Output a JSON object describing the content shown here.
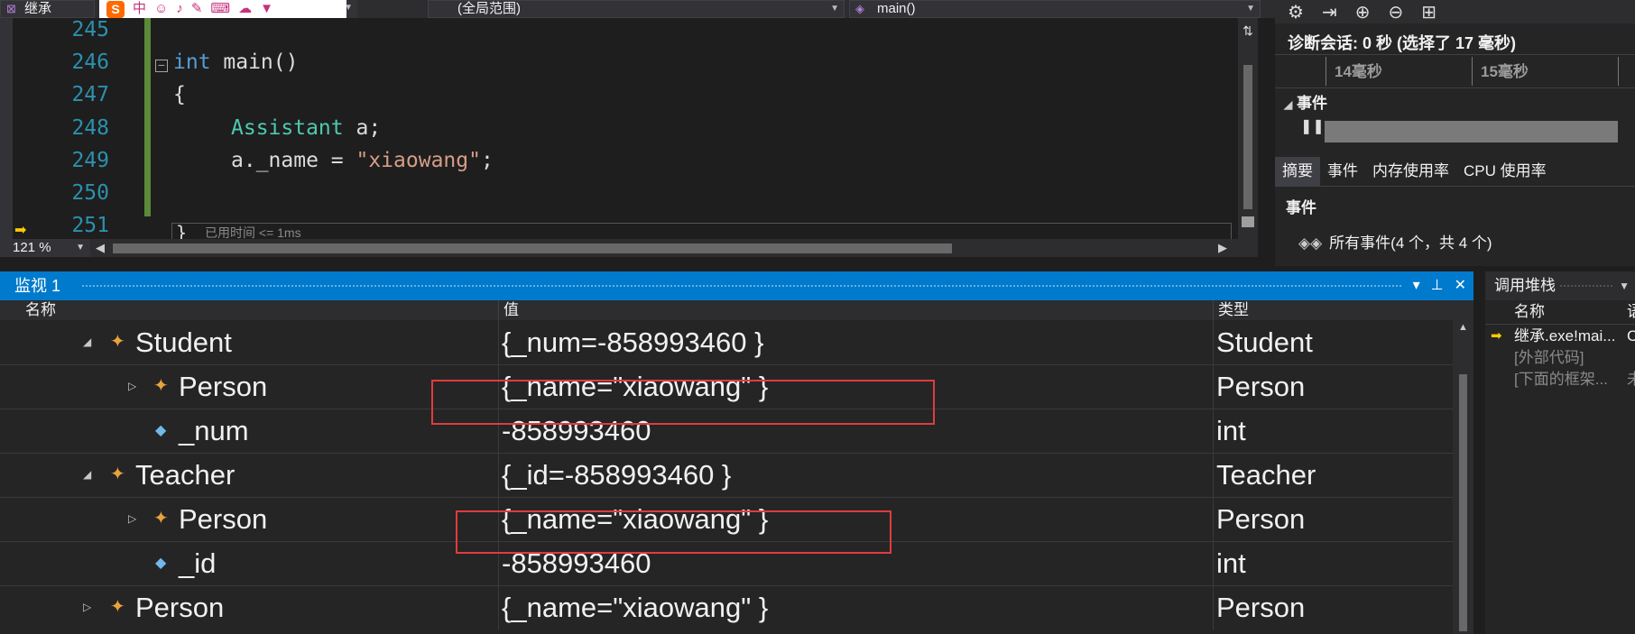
{
  "nav": {
    "project_label": "继承",
    "scope_label": "(全局范围)",
    "function_label": "main()"
  },
  "editor": {
    "lines": [
      {
        "num": "245"
      },
      {
        "num": "246",
        "kw": "int",
        "rest": " main()"
      },
      {
        "num": "247",
        "rest": "{"
      },
      {
        "num": "248",
        "type": "Assistant",
        "rest": " a;"
      },
      {
        "num": "249",
        "pre": "a._name = ",
        "str": "\"xiaowang\"",
        "post": ";"
      },
      {
        "num": "250"
      },
      {
        "num": "251",
        "rest": "}"
      }
    ],
    "elapsed": "已用时间 <= 1ms",
    "zoom": "121 %"
  },
  "diagnostics": {
    "session": "诊断会话: 0 秒 (选择了 17 毫秒)",
    "ticks": [
      "14毫秒",
      "15毫秒"
    ],
    "events_header": "事件",
    "tabs": [
      "摘要",
      "事件",
      "内存使用率",
      "CPU 使用率"
    ],
    "events_section": "事件",
    "all_events": "所有事件(4 个，共 4 个)"
  },
  "watch": {
    "title": "监视 1",
    "col_name": "名称",
    "col_value": "值",
    "col_type": "类型",
    "rows": [
      {
        "name": "Student",
        "value": "{_num=-858993460 }",
        "type": "Student"
      },
      {
        "name": "Person",
        "value": "{_name=\"xiaowang\" }",
        "type": "Person"
      },
      {
        "name": "_num",
        "value": "-858993460",
        "type": "int"
      },
      {
        "name": "Teacher",
        "value": "{_id=-858993460 }",
        "type": "Teacher"
      },
      {
        "name": "Person",
        "value": "{_name=\"xiaowang\" }",
        "type": "Person"
      },
      {
        "name": "_id",
        "value": "-858993460",
        "type": "int"
      },
      {
        "name": "Person",
        "value": "{_name=\"xiaowang\" }",
        "type": "Person"
      }
    ]
  },
  "callstack": {
    "title": "调用堆栈",
    "col_name": "名称",
    "col_lang": "语",
    "rows": [
      {
        "name": "继承.exe!mai...",
        "lang": "C"
      },
      {
        "name": "[外部代码]",
        "lang": ""
      },
      {
        "name": "[下面的框架...",
        "lang": "未"
      }
    ]
  }
}
